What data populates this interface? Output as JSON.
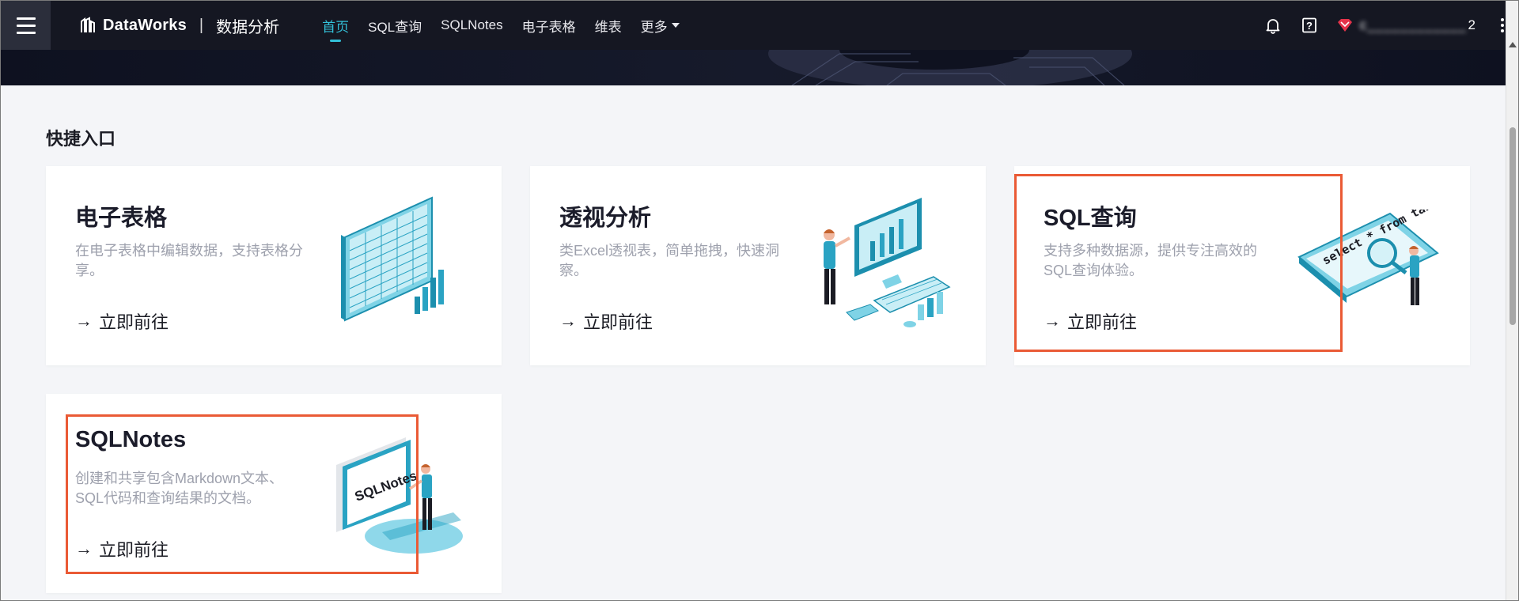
{
  "topbar": {
    "brand_name": "DataWorks",
    "brand_separator": "|",
    "product_name": "数据分析",
    "nav": [
      {
        "label": "首页",
        "active": true
      },
      {
        "label": "SQL查询",
        "active": false
      },
      {
        "label": "SQLNotes",
        "active": false
      },
      {
        "label": "电子表格",
        "active": false
      },
      {
        "label": "维表",
        "active": false
      },
      {
        "label": "更多",
        "active": false,
        "dropdown": true
      }
    ],
    "user_name_visible_tail": "2",
    "icons": [
      "bell-icon",
      "help-icon",
      "user-badge-icon",
      "more-vertical-icon"
    ]
  },
  "main": {
    "section_title": "快捷入口",
    "cards": [
      {
        "title": "电子表格",
        "desc": "在电子表格中编辑数据，支持表格分享。",
        "link": "立即前往",
        "illustration": "spreadsheet-illustration"
      },
      {
        "title": "透视分析",
        "desc": "类Excel透视表，简单拖拽，快速洞察。",
        "link": "立即前往",
        "illustration": "pivot-analysis-illustration"
      },
      {
        "title": "SQL查询",
        "desc": "支持多种数据源，提供专注高效的SQL查询体验。",
        "link": "立即前往",
        "illustration": "sql-query-illustration",
        "illustration_text": "select * from table"
      },
      {
        "title": "SQLNotes",
        "desc": "创建和共享包含Markdown文本、SQL代码和查询结果的文档。",
        "link": "立即前往",
        "illustration": "sqlnotes-illustration",
        "illustration_text": "SQLNotes"
      }
    ],
    "link_arrow": "→"
  },
  "colors": {
    "topbar_bg": "#151722",
    "accent": "#33c0d8",
    "highlight_border": "#ea5a35",
    "page_bg": "#f4f5f8"
  }
}
